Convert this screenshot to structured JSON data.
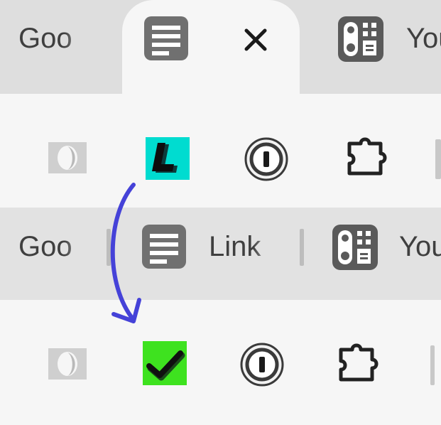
{
  "top_state": {
    "tabs": [
      {
        "label": "Goo",
        "icon": "document-partial-icon"
      },
      {
        "label": "",
        "icon": "document-icon",
        "close_label": "×",
        "active": true
      },
      {
        "label": "You",
        "icon": "remote-grid-icon"
      }
    ],
    "toolbar": [
      "capture-icon",
      "linkclump-L-icon",
      "password-manager-icon",
      "extensions-puzzle-icon"
    ]
  },
  "bottom_state": {
    "tabs": [
      {
        "label": "Goo",
        "icon": "document-partial-icon"
      },
      {
        "label": "Link",
        "icon": "document-icon"
      },
      {
        "label": "You",
        "icon": "remote-grid-icon"
      }
    ],
    "toolbar": [
      "capture-icon",
      "checkmark-icon",
      "password-manager-icon",
      "extensions-puzzle-icon"
    ]
  },
  "colors": {
    "link_icon_bg": "#00dcd0",
    "check_icon_bg": "#3ee21f",
    "arrow": "#4542d8",
    "icon_dark": "#2d2d2d",
    "icon_gray": "#6f6f6f"
  }
}
